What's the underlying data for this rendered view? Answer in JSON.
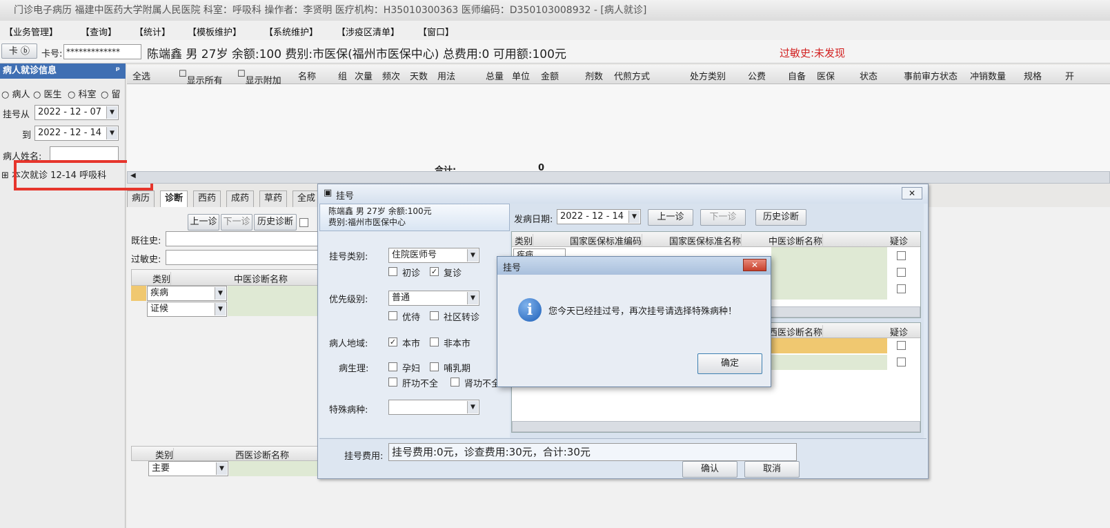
{
  "window": {
    "title": "门诊电子病历  福建中医药大学附属人民医院  科室：呼吸科  操作者：李贤明  医疗机构：H35010300363  医师编码：D350103008932 - [病人就诊]"
  },
  "menu": [
    "【业务管理】",
    "【查询】",
    "【统计】",
    "【模板维护】",
    "【系统维护】",
    "【涉疫区清单】",
    "【窗口】"
  ],
  "patient_bar": {
    "card_button": "卡 ⓑ",
    "card_label": "卡号:",
    "card_value": "*************",
    "summary": "陈端鑫  男  27岁  余额:100  费别:市医保(福州市医保中心)  总费用:0  可用额:100元",
    "allergy": "过敏史:未发现"
  },
  "left_panel": {
    "title": "病人就诊信息",
    "pin": "ᵖ",
    "radios": [
      "病人",
      "医生",
      "科室",
      "留"
    ],
    "from_label": "挂号从",
    "from_date": "2022 - 12 - 07",
    "to_label": "到",
    "to_date": "2022 - 12 - 14",
    "name_label": "病人姓名:",
    "visit_item": "本次就诊  12-14  呼吸科",
    "expand": "⊞"
  },
  "rx_grid": {
    "select_all": "全选",
    "show_all": "显示所有",
    "show_extra": "显示附加",
    "columns": [
      "名称",
      "组",
      "次量",
      "频次",
      "天数",
      "用法",
      "总量",
      "单位",
      "金额",
      "剂数",
      "代煎方式",
      "处方类别",
      "公费",
      "自备",
      "医保",
      "状态",
      "事前审方状态",
      "冲销数量",
      "规格",
      "开"
    ],
    "total_label": "合计:",
    "total_value": "0"
  },
  "tabs": [
    "病历",
    "诊断",
    "西药",
    "成药",
    "草药",
    "全成"
  ],
  "diag_panel": {
    "prev": "上一诊",
    "next": "下一诊",
    "history": "历史诊断",
    "past_history": "既往史:",
    "allergy_history": "过敏史:",
    "tcm_headers": [
      "类别",
      "中医诊断名称"
    ],
    "tcm_rows": [
      "疾病",
      "证候"
    ],
    "wm_headers": [
      "类别",
      "西医诊断名称"
    ],
    "wm_rows": [
      "主要"
    ]
  },
  "reg_dialog": {
    "title": "挂号",
    "patient_line1": "陈端鑫  男  27岁  余额:100元",
    "patient_line2": "费别:福州市医保中心",
    "reg_type_label": "挂号类别:",
    "reg_type_value": "住院医师号",
    "first_visit": "初诊",
    "revisit": "复诊",
    "priority_label": "优先级别:",
    "priority_value": "普通",
    "priority_opts": [
      "优待",
      "社区转诊"
    ],
    "region_label": "病人地域:",
    "local": "本市",
    "nonlocal": "非本市",
    "physio_label": "病生理:",
    "physio_opts": [
      "孕妇",
      "哺乳期",
      "肝功不全",
      "肾功不全"
    ],
    "special_label": "特殊病种:",
    "fee_label": "挂号费用:",
    "fee_value": "挂号费用:0元，诊查费用:30元，合计:30元",
    "confirm": "确认",
    "cancel": "取消",
    "onset_label": "发病日期:",
    "onset_date": "2022 - 12 - 14",
    "prev": "上一诊",
    "next": "下一诊",
    "history": "历史诊断",
    "grid1_headers": [
      "类别",
      "国家医保标准编码",
      "国家医保标准名称",
      "中医诊断名称",
      "疑诊"
    ],
    "grid1_row": "疾病",
    "grid2_headers": [
      "西医诊断名称",
      "疑诊"
    ]
  },
  "msg_dialog": {
    "title": "挂号",
    "close": "✕",
    "icon": "i",
    "message": "您今天已经挂过号，再次挂号请选择特殊病种！",
    "ok": "确定"
  },
  "colors": {
    "accent": "#3f6fb3",
    "allergy": "#d22222",
    "highlight": "#e6352c"
  }
}
